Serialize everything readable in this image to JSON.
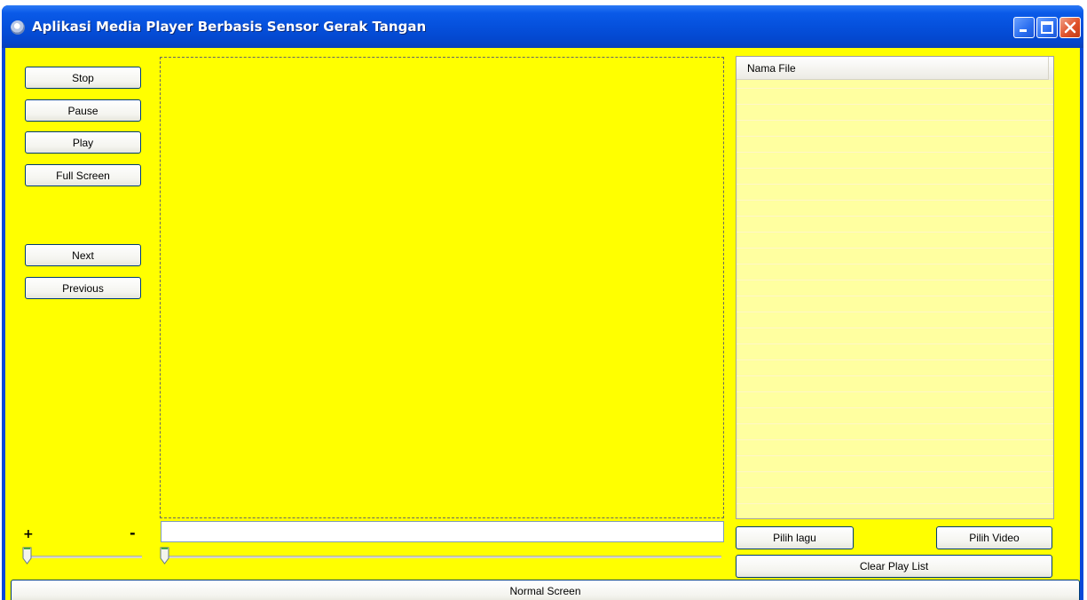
{
  "window": {
    "title": "Aplikasi Media Player Berbasis Sensor Gerak Tangan"
  },
  "colors": {
    "background": "#ffff00",
    "titlebar": "#0550dc",
    "playlist_row": "#ffffa0"
  },
  "controls": {
    "stop_label": "Stop",
    "pause_label": "Pause",
    "play_label": "Play",
    "fullscreen_label": "Full Screen",
    "next_label": "Next",
    "previous_label": "Previous",
    "normal_screen_label": "Normal Screen"
  },
  "volume": {
    "plus_label": "+",
    "minus_label": "-",
    "level": 0
  },
  "seek": {
    "position": 0,
    "text_value": ""
  },
  "playlist": {
    "column_header": "Nama File",
    "items": [],
    "pilih_lagu_label": "Pilih lagu",
    "pilih_video_label": "Pilih Video",
    "clear_label": "Clear Play List"
  },
  "icons": {
    "app": "media-disc-icon",
    "minimize": "minimize-icon",
    "maximize": "maximize-icon",
    "close": "close-icon"
  }
}
